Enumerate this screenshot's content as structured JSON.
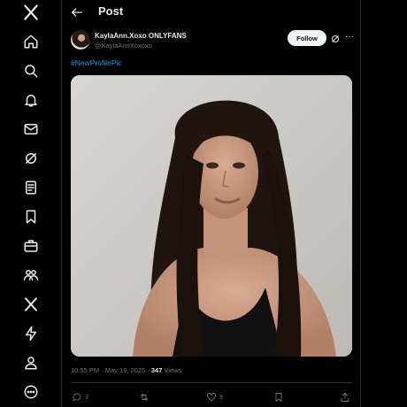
{
  "nav": {
    "items": [
      {
        "icon": "x-logo-icon"
      },
      {
        "icon": "home-icon"
      },
      {
        "icon": "search-icon"
      },
      {
        "icon": "bell-icon"
      },
      {
        "icon": "mail-icon"
      },
      {
        "icon": "grok-icon"
      },
      {
        "icon": "lists-icon"
      },
      {
        "icon": "bookmark-icon"
      },
      {
        "icon": "briefcase-icon"
      },
      {
        "icon": "communities-icon"
      },
      {
        "icon": "x-premium-icon"
      },
      {
        "icon": "lightning-icon"
      },
      {
        "icon": "profile-icon"
      },
      {
        "icon": "more-circle-icon"
      }
    ]
  },
  "header": {
    "title": "Post"
  },
  "post": {
    "display_name": "KaylaAnn.Xoxo ONLYFANS",
    "handle": "@KaylaAnnXoxoxo",
    "follow_label": "Follow",
    "more_label": "···",
    "hashtag": "#NewProfilePic",
    "time": "10:55 PM · May 19, 2025 · ",
    "views_count": "347",
    "views_label": " Views",
    "actions": {
      "replies": "3",
      "reposts": "",
      "likes": "9"
    }
  },
  "colors": {
    "background": "#000000",
    "text": "#e7e9ea",
    "muted": "#71767b",
    "accent": "#1d9bf0",
    "border": "#2f3336"
  }
}
